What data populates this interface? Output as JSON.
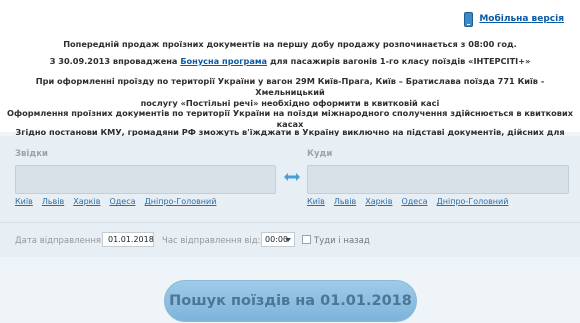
{
  "header": {
    "mobile_link": "Мобільна версія",
    "mobile_icon": "phone-icon"
  },
  "notices": {
    "n1": "Попередній продаж проїзних документів на першу добу продажу розпочинається з 08:00 год.",
    "n2_before": "З 30.09.2013 впроваджена ",
    "n2_link": "Бонусна програма",
    "n2_after": " для пасажирів вагонів 1-го класу поїздів «ІНТЕРСІТІ+»",
    "n3_line1": "При оформленні проїзду по території України у вагон 29М Київ-Прага, Київ – Братислава поїзда 771 Київ - Хмельницький",
    "n3_line2": "послугу «Постільні речі» необхідно оформити в квитковій касі",
    "n4": "Оформлення проїзних документів по території України на поїзди міжнародного сполучення здійснюється в квиткових касах",
    "n5": "Згідно постанови КМУ, громадяни РФ зможуть в'їжджати в Україну виключно на підставі документів, дійсних для виїзду за кордон"
  },
  "form": {
    "from_label": "Звідки",
    "to_label": "Куди",
    "from_value": "",
    "to_value": "",
    "quick_stations": [
      "Київ",
      "Львів",
      "Харків",
      "Одеса",
      "Дніпро-Головний"
    ],
    "swap_icon": "swap-arrows-icon",
    "date_label": "Дата відправлення:",
    "date_value": "01.01.2018",
    "time_label": "Час відправлення від:",
    "time_value": "00:00",
    "roundtrip_label": "Туди і назад",
    "roundtrip_checked": false,
    "search_button": "Пошук поїздів на 01.01.2018"
  },
  "colors": {
    "link": "#0b5aa4",
    "form_bg": "#e8eff4",
    "button": "#8fc0e2"
  }
}
